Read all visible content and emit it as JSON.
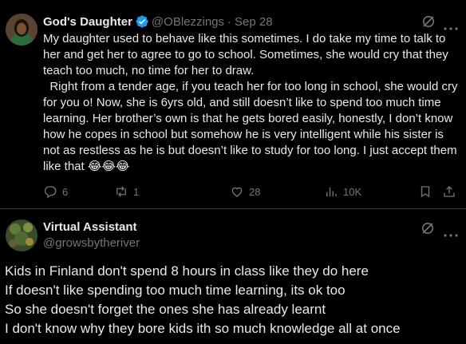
{
  "tweet1": {
    "author_name": "God's Daughter",
    "handle": "@OBlezzings",
    "separator": "·",
    "date": "Sep 28",
    "text": "My daughter used to behave like this sometimes. I do take my time to talk to her and get her to agree to go to school. Sometimes, she would cry that they teach too much, no time for her to draw.\n  Right from a tender age, if you teach her for too long in school, she would cry for you o! Now, she is 6yrs old, and still doesn’t like to spend too much time learning. Her brother’s own is that he gets bored easily, honestly, I don’t know how he copes in school but somehow he is very intelligent while his sister is not as restless as he is but doesn’t like to study for too long. I just accept them like that 😂😂😂",
    "stats": {
      "replies": "6",
      "reposts": "1",
      "likes": "28",
      "views": "10K"
    },
    "icons": [
      "verified-badge-icon",
      "grok-icon",
      "more-icon",
      "reply-icon",
      "repost-icon",
      "like-icon",
      "views-icon",
      "bookmark-icon",
      "share-icon"
    ]
  },
  "tweet2": {
    "author_name": "Virtual Assistant",
    "handle": "@growsbytheriver",
    "lines": [
      "Kids in Finland don't spend 8 hours in class like they do here",
      "If doesn't like spending too much time learning, its ok too",
      "So she doesn't forget the ones she has already learnt",
      "I don't know why they bore kids ith so much knowledge all at once"
    ],
    "icons": [
      "grok-icon",
      "more-icon"
    ]
  },
  "colors": {
    "background": "#000000",
    "text_primary": "#e7e9ea",
    "text_secondary": "#71767b",
    "verified_blue": "#1d9bf0",
    "divider": "#2f3336"
  }
}
